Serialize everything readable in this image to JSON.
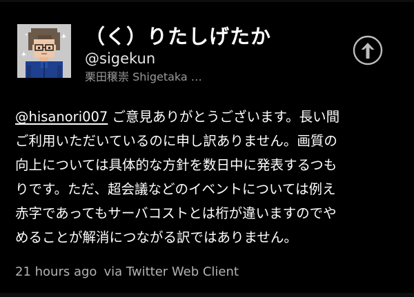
{
  "profile": {
    "display_name": "（く）りたしげたか",
    "handle": "@sigekun",
    "full_name": "栗田穣崇 Shigetaka …",
    "avatar_icon": "pixel-avatar-icon"
  },
  "actions": {
    "share_icon": "up-arrow-circle-icon"
  },
  "tweet": {
    "mention": "@hisanori007",
    "lines": [
      " ご意見ありがとうございます。長い間",
      "ご利用いただいているのに申し訳ありません。画質の",
      "向上については具体的な方針を数日中に発表するつも",
      "りです。ただ、超会議などのイベントについては例え",
      "赤字であってもサーバコストとは桁が違いますのでや",
      "めることが解消につながる訳ではありません。"
    ]
  },
  "meta": {
    "timestamp": "21 hours ago",
    "client": "via Twitter Web Client"
  },
  "colors": {
    "background": "#000000",
    "text": "#ffffff",
    "secondary_text": "#9a9a9a",
    "avatar_bg": "#c7c7c7",
    "shirt": "#1f3f8f"
  }
}
